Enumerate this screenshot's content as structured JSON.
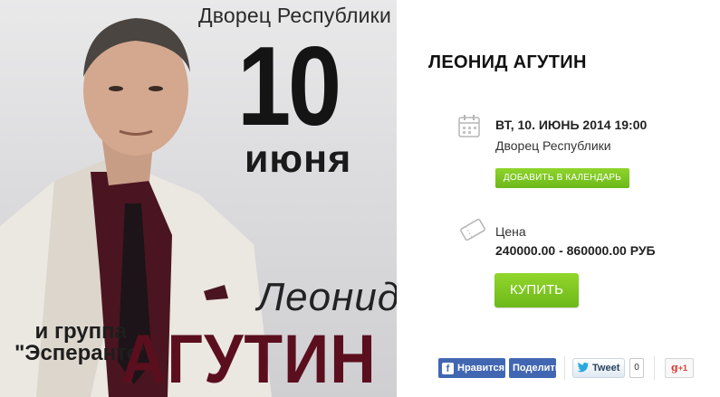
{
  "poster": {
    "venue": "Дворец Республики",
    "day": "10",
    "month": "июня",
    "first_name": "Леонид",
    "group": "и группа \"Эсперанто\"",
    "last_name": "АГУТИН",
    "colors": {
      "last_name": "#5b0f1e",
      "jacket": "#ebe7e1",
      "shirt": "#4a1520"
    }
  },
  "event": {
    "title": "ЛЕОНИД АГУТИН",
    "date": "ВТ, 10. ИЮНЬ 2014 19:00",
    "venue": "Дворец Республики",
    "add_to_calendar": "ДОБАВИТЬ В КАЛЕНДАРЬ",
    "price_label": "Цена",
    "price_range": "240000.00 - 860000.00 РУБ",
    "buy": "КУПИТЬ",
    "icons": {
      "calendar": "calendar-icon",
      "ticket": "ticket-icon"
    },
    "colors": {
      "accent_green": "#7cc520"
    }
  },
  "social": {
    "fb_like": "Нравится",
    "fb_share": "Поделиться",
    "tweet": "Tweet",
    "tweet_count": "0",
    "gplus": "+1"
  }
}
